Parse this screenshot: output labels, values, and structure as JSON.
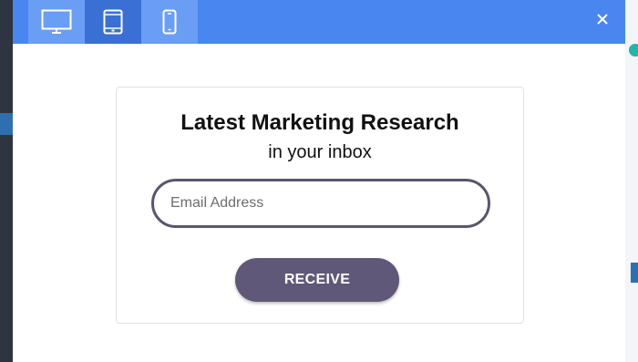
{
  "toolbar": {
    "devices": [
      {
        "name": "desktop",
        "icon": "desktop-icon",
        "active": false
      },
      {
        "name": "tablet",
        "icon": "tablet-icon",
        "active": true
      },
      {
        "name": "mobile",
        "icon": "mobile-icon",
        "active": false
      }
    ],
    "close_icon": "close-icon",
    "bar_color": "#4a86f0"
  },
  "form": {
    "title": "Latest Marketing Research",
    "subtitle": "in your inbox",
    "email_placeholder": "Email Address",
    "email_value": "",
    "submit_label": "RECEIVE",
    "button_color": "#5f5878"
  }
}
